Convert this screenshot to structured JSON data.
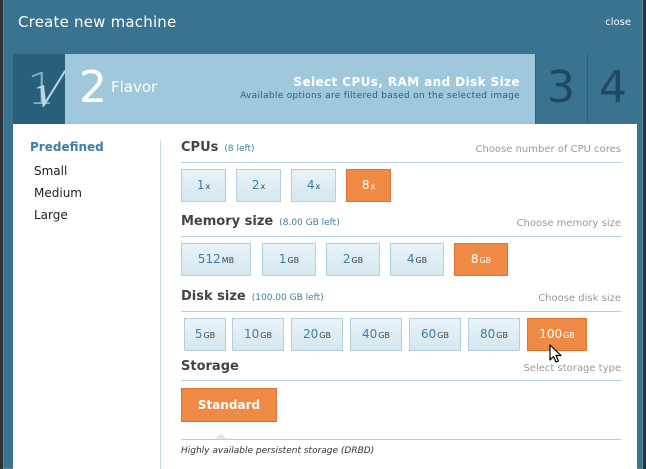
{
  "dialog": {
    "title": "Create new machine",
    "close_label": "close"
  },
  "steps": {
    "step1_number": "1",
    "step1_check": "√",
    "current_number": "2",
    "current_name": "Flavor",
    "headline": "Select CPUs, RAM and Disk Size",
    "subtitle": "Available options are filtered based on the selected image",
    "step3_number": "3",
    "step4_number": "4"
  },
  "sidebar": {
    "heading": "Predefined",
    "items": [
      {
        "label": "Small"
      },
      {
        "label": "Medium"
      },
      {
        "label": "Large"
      }
    ]
  },
  "cpus": {
    "title": "CPUs",
    "left": "(8 left)",
    "hint": "Choose number of CPU cores",
    "options": [
      {
        "value": "1",
        "unit": "x"
      },
      {
        "value": "2",
        "unit": "x"
      },
      {
        "value": "4",
        "unit": "x"
      },
      {
        "value": "8",
        "unit": "x"
      }
    ],
    "selected": "8"
  },
  "memory": {
    "title": "Memory size",
    "left": "(8.00 GB left)",
    "hint": "Choose memory size",
    "options": [
      {
        "value": "512",
        "unit": "MB"
      },
      {
        "value": "1",
        "unit": "GB"
      },
      {
        "value": "2",
        "unit": "GB"
      },
      {
        "value": "4",
        "unit": "GB"
      },
      {
        "value": "8",
        "unit": "GB"
      }
    ],
    "selected": "8"
  },
  "disk": {
    "title": "Disk size",
    "left": "(100.00 GB left)",
    "hint": "Choose disk size",
    "options": [
      {
        "value": "5",
        "unit": "GB"
      },
      {
        "value": "10",
        "unit": "GB"
      },
      {
        "value": "20",
        "unit": "GB"
      },
      {
        "value": "40",
        "unit": "GB"
      },
      {
        "value": "60",
        "unit": "GB"
      },
      {
        "value": "80",
        "unit": "GB"
      },
      {
        "value": "100",
        "unit": "GB"
      }
    ],
    "selected": "100"
  },
  "storage": {
    "title": "Storage",
    "hint": "Select storage type",
    "option_label": "Standard",
    "description": "Highly available persistent storage (DRBD)"
  },
  "colors": {
    "accent_orange": "#ef8a45",
    "header_blue": "#3a7390",
    "active_step": "#9fc8dd"
  }
}
